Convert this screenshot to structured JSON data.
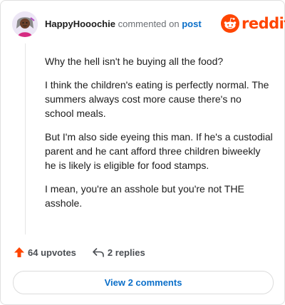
{
  "header": {
    "username": "HappyHooochie",
    "action_text": "commented on",
    "post_link": "post",
    "brand": "reddit"
  },
  "comment": {
    "paragraphs": [
      "Why the hell isn't he buying all the food?",
      "I think the children's eating is perfectly normal. The summers always cost more cause there's no school meals.",
      "But I'm also side eyeing this man. If he's a custodial parent and he cant afford three children biweekly he is likely is eligible for food stamps.",
      "I mean, you're an asshole but you're not THE asshole."
    ]
  },
  "actions": {
    "upvotes": "64 upvotes",
    "replies": "2 replies"
  },
  "footer": {
    "view_comments": "View 2 comments"
  },
  "colors": {
    "brand": "#ff4500",
    "link": "#0b6fc9",
    "muted_text": "#6b6f74"
  },
  "icons": {
    "avatar": "user-avatar",
    "brand": "reddit-snoo-icon",
    "upvote": "upvote-arrow-icon",
    "reply": "reply-arrow-icon"
  }
}
